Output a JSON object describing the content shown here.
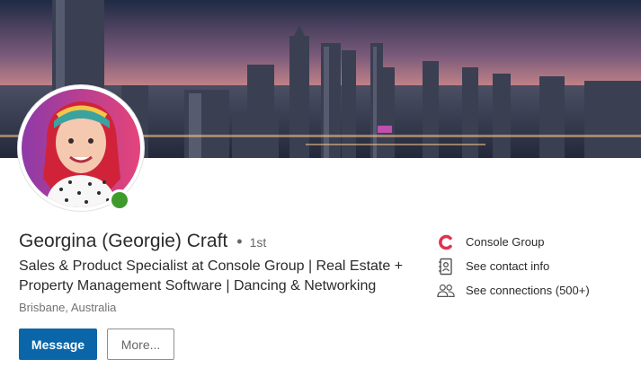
{
  "profile": {
    "name": "Georgina (Georgie) Craft",
    "separator": "•",
    "degree": "1st",
    "headline": "Sales & Product Specialist at Console Group | Real Estate + Property Management Software | Dancing & Networking",
    "location": "Brisbane, Australia",
    "online": true
  },
  "actions": {
    "message_label": "Message",
    "more_label": "More..."
  },
  "side": {
    "company": "Console Group",
    "contact_info": "See contact info",
    "connections": "See connections (500+)"
  },
  "icons": {
    "company": "console-group-logo-icon",
    "contact": "address-book-icon",
    "connections": "people-icon"
  },
  "colors": {
    "primary": "#0a66a8",
    "online": "#3f9a2c",
    "company_logo": "#e0334d"
  }
}
